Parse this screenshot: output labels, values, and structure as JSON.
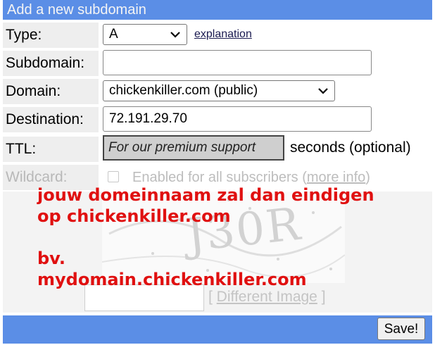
{
  "header": {
    "title": "Add a new subdomain"
  },
  "form": {
    "type": {
      "label": "Type:",
      "value": "A",
      "explanation_link": "explanation"
    },
    "subdomain": {
      "label": "Subdomain:",
      "value": ""
    },
    "domain": {
      "label": "Domain:",
      "value": "chickenkiller.com (public)"
    },
    "destination": {
      "label": "Destination:",
      "value": "72.191.29.70"
    },
    "ttl": {
      "label": "TTL:",
      "value": "For our premium support",
      "suffix": "seconds (optional)"
    },
    "wildcard": {
      "label": "Wildcard:",
      "checked": false,
      "checkbox_text": "Enabled for all subscribers (",
      "more_info": "more info",
      "close_paren": ")"
    }
  },
  "captcha": {
    "image_text": "J30R",
    "input_value": "",
    "different_open": "[ ",
    "different_image": "Different Image",
    "different_close": " ]"
  },
  "footer": {
    "save_label": "Save!"
  },
  "overlay": {
    "line1": "jouw domeinnaam zal dan eindigen",
    "line2": "op chickenkiller.com",
    "line3": "bv.",
    "line4": "mydomain.chickenkiller.com"
  },
  "colors": {
    "header_bg": "#5b8ee6",
    "overlay_text": "#e01010"
  }
}
